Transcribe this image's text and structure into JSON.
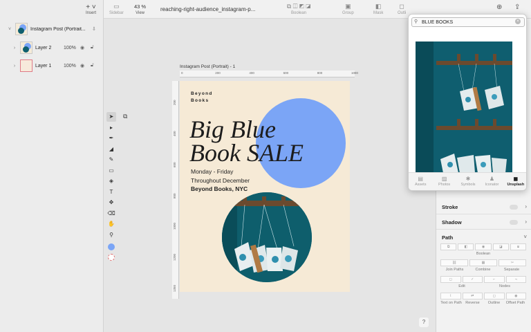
{
  "insert": {
    "label": "Insert"
  },
  "layers": [
    {
      "name": "Instagram Post (Portrait...",
      "expanded": true
    },
    {
      "name": "Layer 2",
      "opacity": "100%"
    },
    {
      "name": "Layer 1",
      "opacity": "100%"
    }
  ],
  "toolbar": {
    "sidebar_label": "Sidebar",
    "zoom": "43 %",
    "view_label": "View",
    "document_title": "reaching-right-audience_instagram-p...",
    "boolean_label": "Boolean",
    "group_label": "Group",
    "mask_label": "Mask",
    "outline_label": "Outli"
  },
  "artboard": {
    "title": "Instagram Post (Portrait) - 1",
    "ruler_h": [
      "0",
      "200",
      "400",
      "600",
      "800",
      "1080"
    ],
    "ruler_v": [
      "200",
      "400",
      "600",
      "800",
      "1000",
      "1200",
      "1350"
    ],
    "brand_line1": "Beyond",
    "brand_line2": "Books",
    "headline_line1": "Big Blue",
    "headline_line2": "Book SALE",
    "sub1": "Monday - Friday",
    "sub2": "Throughout December",
    "sub3": "Beyond Books, NYC",
    "circle_color": "#7ba5f6",
    "background_color": "#f6ead6"
  },
  "panel": {
    "stroke_label": "Stroke",
    "shadow_label": "Shadow",
    "path_label": "Path",
    "boolean_label": "Boolean",
    "join_paths": "Join Paths",
    "combine": "Combine",
    "separate": "Separate",
    "edit": "Edit",
    "nodes": "Nodes",
    "text_on_path": "Text on Path",
    "reverse": "Reverse",
    "outline": "Outline",
    "offset_path": "Offset Path"
  },
  "popup": {
    "search_value": "BLUE BOOKS",
    "tabs": [
      {
        "label": "Assets",
        "icon": "assets-icon"
      },
      {
        "label": "Photos",
        "icon": "photos-icon"
      },
      {
        "label": "Symbols",
        "icon": "symbols-icon"
      },
      {
        "label": "Iconator",
        "icon": "iconator-icon"
      },
      {
        "label": "Unsplash",
        "icon": "unsplash-icon",
        "selected": true
      }
    ]
  },
  "help": "?"
}
